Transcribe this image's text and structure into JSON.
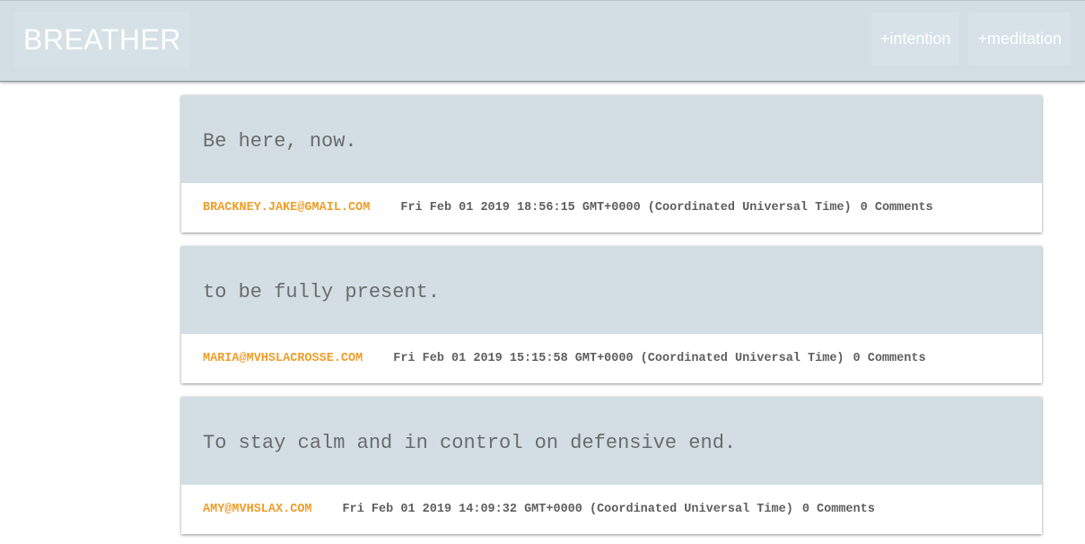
{
  "header": {
    "brand": "BREATHER",
    "nav": [
      {
        "label": "+intention"
      },
      {
        "label": "+meditation"
      }
    ]
  },
  "posts": [
    {
      "title": "Be here, now.",
      "author": "BRACKNEY.JAKE@GMAIL.COM",
      "date": "Fri Feb 01 2019 18:56:15 GMT+0000 (Coordinated Universal Time)",
      "comments": "0 Comments"
    },
    {
      "title": "to be fully present.",
      "author": "MARIA@MVHSLACROSSE.COM",
      "date": "Fri Feb 01 2019 15:15:58 GMT+0000 (Coordinated Universal Time)",
      "comments": "0 Comments"
    },
    {
      "title": "To stay calm and in control on defensive end.",
      "author": "AMY@MVHSLAX.COM",
      "date": "Fri Feb 01 2019 14:09:32 GMT+0000 (Coordinated Universal Time)",
      "comments": "0 Comments"
    }
  ],
  "colors": {
    "header_bg": "#d2dee4",
    "accent": "#ee9d2a",
    "text": "#5e5e5e"
  }
}
